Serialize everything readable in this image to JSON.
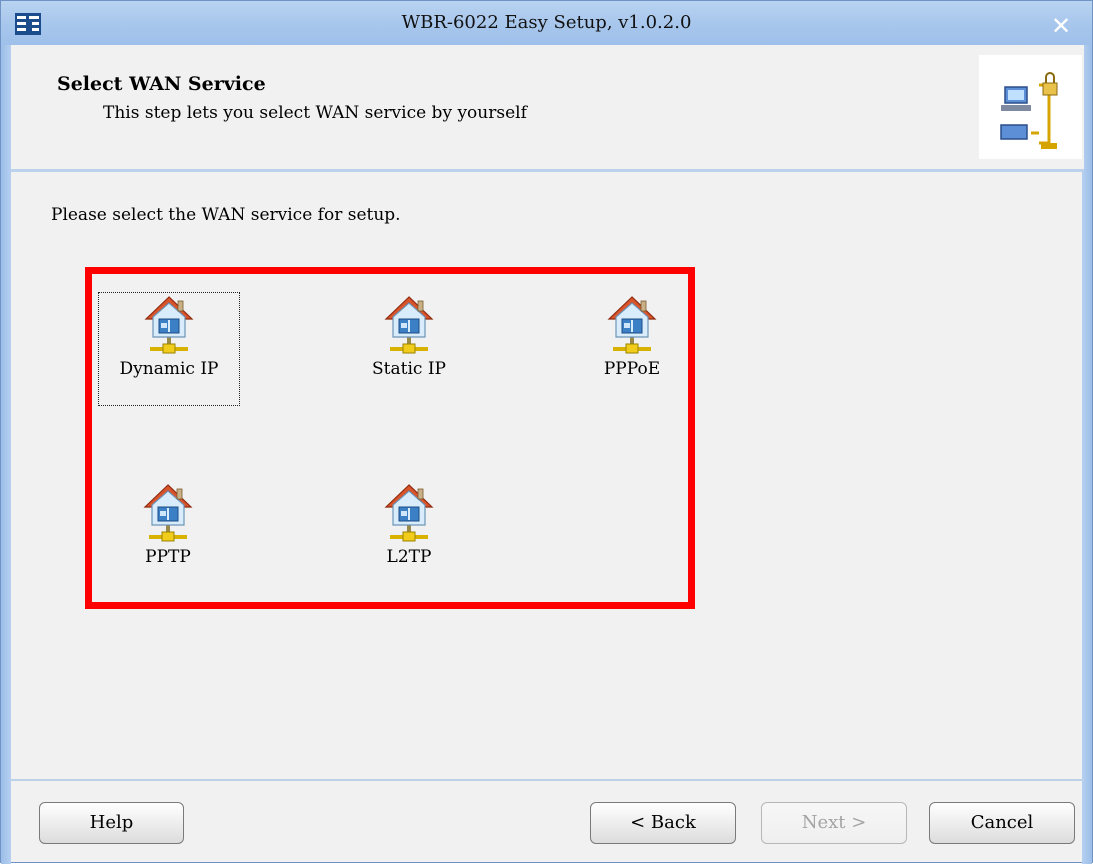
{
  "window": {
    "title": "WBR-6022 Easy Setup, v1.0.2.0"
  },
  "header": {
    "title": "Select WAN Service",
    "subtitle": "This step lets you select WAN service by yourself"
  },
  "content": {
    "prompt": "Please select the WAN service for setup.",
    "services": [
      {
        "label": "Dynamic IP",
        "icon": "house-network-icon",
        "focused": true
      },
      {
        "label": "Static IP",
        "icon": "house-network-icon",
        "focused": false
      },
      {
        "label": "PPPoE",
        "icon": "house-network-icon",
        "focused": false
      },
      {
        "label": "PPTP",
        "icon": "house-network-icon",
        "focused": false
      },
      {
        "label": "L2TP",
        "icon": "house-network-icon",
        "focused": false
      }
    ]
  },
  "buttons": {
    "help": "Help",
    "back": "< Back",
    "next": "Next >",
    "cancel": "Cancel"
  },
  "colors": {
    "highlight": "#ff0000",
    "title_bar": "#a7c6ec",
    "roof": "#d9542b"
  }
}
